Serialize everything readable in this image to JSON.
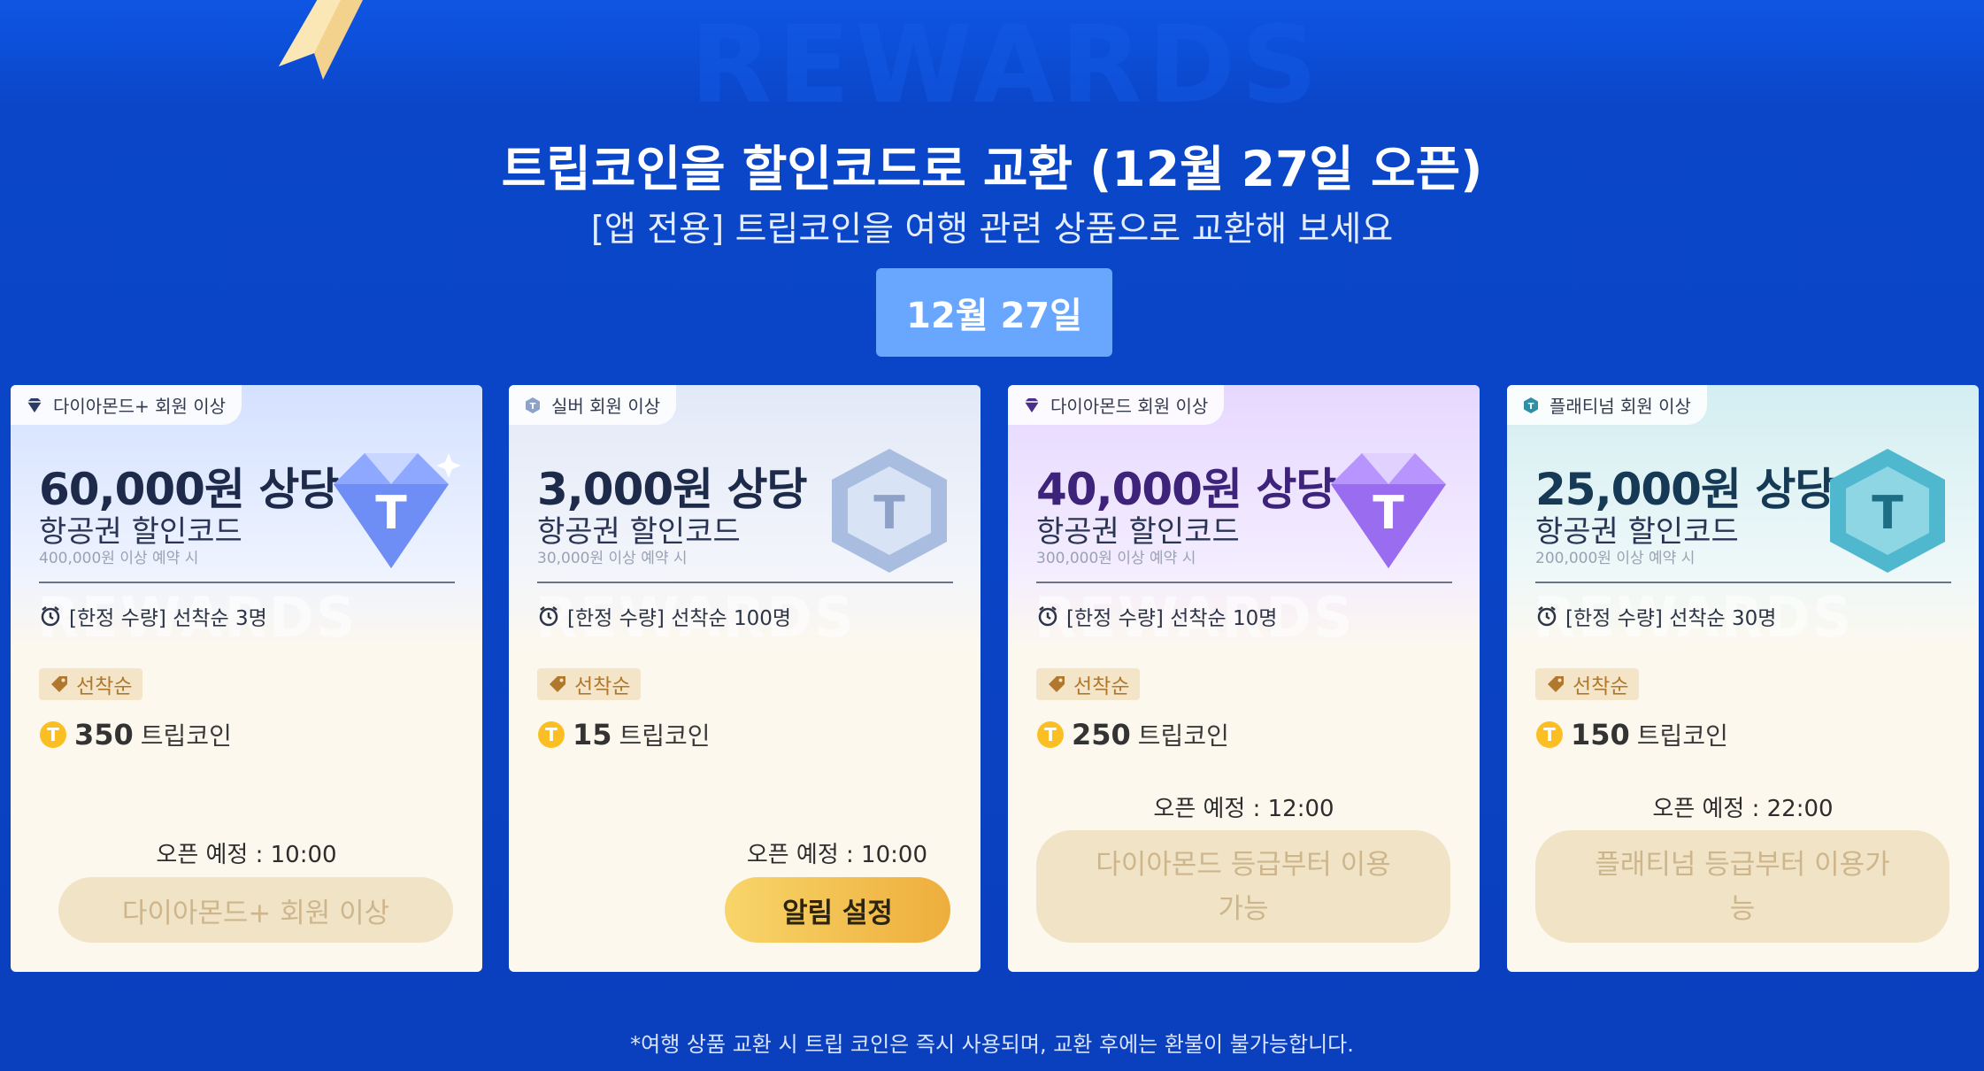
{
  "header": {
    "watermark": "REWARDS",
    "title": "트립코인을 할인코드로 교환 (12월 27일 오픈)",
    "subtitle": "[앱 전용] 트립코인을 여행 관련 상품으로 교환해 보세요",
    "date_tab": "12월 27일"
  },
  "cards": [
    {
      "tier": "다이아몬드+ 회원 이상",
      "tier_icon": "diamond-icon",
      "amount": "60,000원 상당",
      "product": "항공권 할인코드",
      "condition": "400,000원 이상 예약 시",
      "watermark": "REWARDS",
      "limit": "[한정 수량] 선착순 3명",
      "badge": "선착순",
      "price": "350",
      "price_unit": "트립코인",
      "open_time": "오픈 예정 : 10:00",
      "button": "다이아몬드+ 회원 이상",
      "button_state": "disabled",
      "accent": "#7d9bff"
    },
    {
      "tier": "실버 회원 이상",
      "tier_icon": "hexagon-icon",
      "amount": "3,000원 상당",
      "product": "항공권 할인코드",
      "condition": "30,000원 이상 예약 시",
      "watermark": "REWARDS",
      "limit": "[한정 수량] 선착순 100명",
      "badge": "선착순",
      "price": "15",
      "price_unit": "트립코인",
      "open_time": "오픈 예정 : 10:00",
      "button": "알림 설정",
      "button_state": "active",
      "accent": "#9fb3d6"
    },
    {
      "tier": "다이아몬드 회원 이상",
      "tier_icon": "diamond-icon",
      "amount": "40,000원 상당",
      "product": "항공권 할인코드",
      "condition": "300,000원 이상 예약 시",
      "watermark": "REWARDS",
      "limit": "[한정 수량] 선착순 10명",
      "badge": "선착순",
      "price": "250",
      "price_unit": "트립코인",
      "open_time": "오픈 예정 : 12:00",
      "button": "다이아몬드 등급부터 이용가능",
      "button_state": "disabled",
      "accent": "#a67cf3"
    },
    {
      "tier": "플래티넘 회원 이상",
      "tier_icon": "hexagon-icon",
      "amount": "25,000원 상당",
      "product": "항공권 할인코드",
      "condition": "200,000원 이상 예약 시",
      "watermark": "REWARDS",
      "limit": "[한정 수량] 선착순 30명",
      "badge": "선착순",
      "price": "150",
      "price_unit": "트립코인",
      "open_time": "오픈 예정 : 22:00",
      "button": "플래티넘 등급부터 이용가능",
      "button_state": "disabled",
      "accent": "#3fb3c9"
    }
  ],
  "footnote": "*여행 상품 교환 시 트립 코인은 즉시 사용되며, 교환 후에는 환불이 불가능합니다."
}
